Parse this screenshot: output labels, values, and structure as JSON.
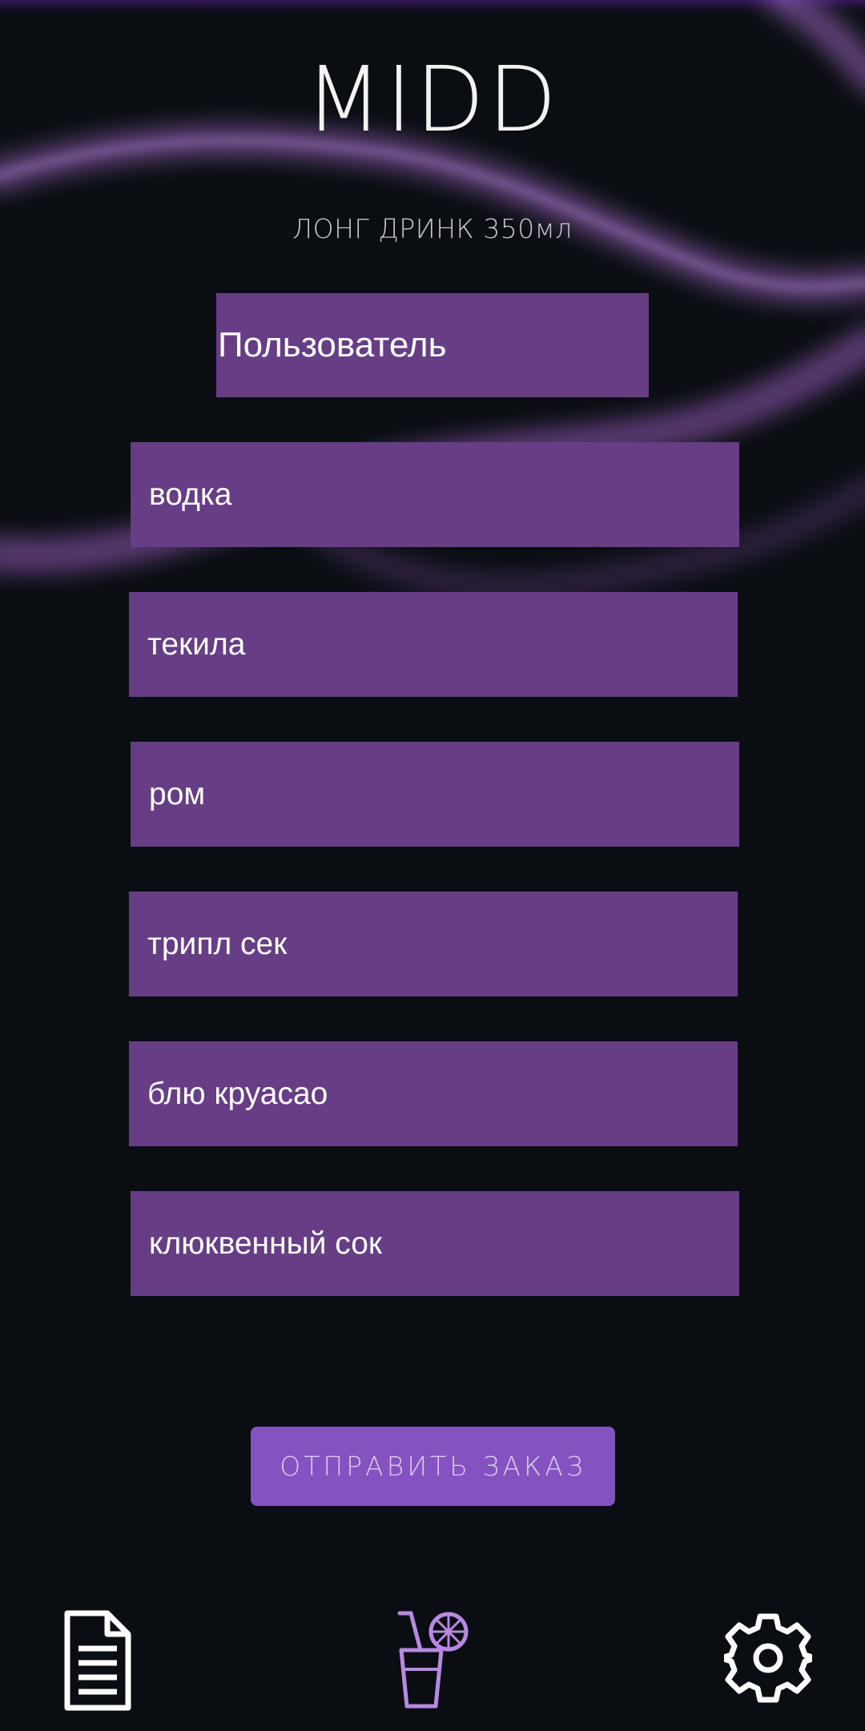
{
  "header": {
    "title": "MIDD",
    "subtitle": "ЛОНГ ДРИНК 350мл"
  },
  "user_field": {
    "value": "Пользователь"
  },
  "ingredients": [
    {
      "label": "водка"
    },
    {
      "label": "текила"
    },
    {
      "label": "ром"
    },
    {
      "label": "трипл сек"
    },
    {
      "label": "блю круасао"
    },
    {
      "label": "клюквенный сок"
    }
  ],
  "submit": {
    "label": "ОТПРАВИТЬ ЗАКАЗ"
  },
  "bottom_nav": {
    "items": [
      {
        "icon": "document-icon",
        "color": "#ffffff"
      },
      {
        "icon": "cocktail-icon",
        "color": "#b889e0"
      },
      {
        "icon": "gear-icon",
        "color": "#ffffff"
      }
    ]
  },
  "colors": {
    "background": "#0a0e12",
    "field": "#673d86",
    "button": "#8552c2",
    "accent": "#b889e0"
  }
}
